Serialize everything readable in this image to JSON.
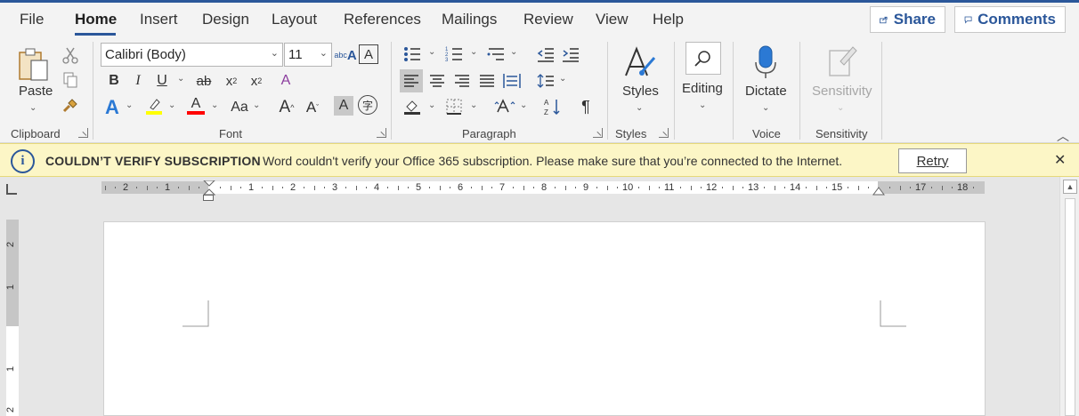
{
  "tabs": [
    "File",
    "Home",
    "Insert",
    "Design",
    "Layout",
    "References",
    "Mailings",
    "Review",
    "View",
    "Help"
  ],
  "header_buttons": {
    "share": "Share",
    "comments": "Comments"
  },
  "ribbon": {
    "clipboard": {
      "paste": "Paste",
      "group": "Clipboard"
    },
    "font": {
      "name": "Calibri (Body)",
      "size": "11",
      "group": "Font"
    },
    "paragraph": {
      "group": "Paragraph"
    },
    "styles": {
      "label": "Styles",
      "group": "Styles"
    },
    "editing": {
      "label": "Editing"
    },
    "voice": {
      "dictate": "Dictate",
      "group": "Voice"
    },
    "sensitivity": {
      "label": "Sensitivity",
      "group": "Sensitivity"
    }
  },
  "notification": {
    "title": "COULDN’T VERIFY SUBSCRIPTION",
    "message": "Word couldn't verify your Office 365 subscription. Please make sure that you’re connected to the Internet.",
    "retry": "Retry"
  },
  "ruler": {
    "horizontal": [
      "2",
      "1",
      "1",
      "2",
      "3",
      "4",
      "5",
      "6",
      "7",
      "8",
      "9",
      "10",
      "11",
      "12",
      "13",
      "14",
      "15",
      "17",
      "18"
    ],
    "vertical": [
      "2",
      "1",
      "1",
      "2"
    ]
  },
  "colors": {
    "accent": "#2b579a",
    "notification_bg": "#fcf6c6",
    "highlight": "#ffff00",
    "font_color": "#ff0000"
  }
}
